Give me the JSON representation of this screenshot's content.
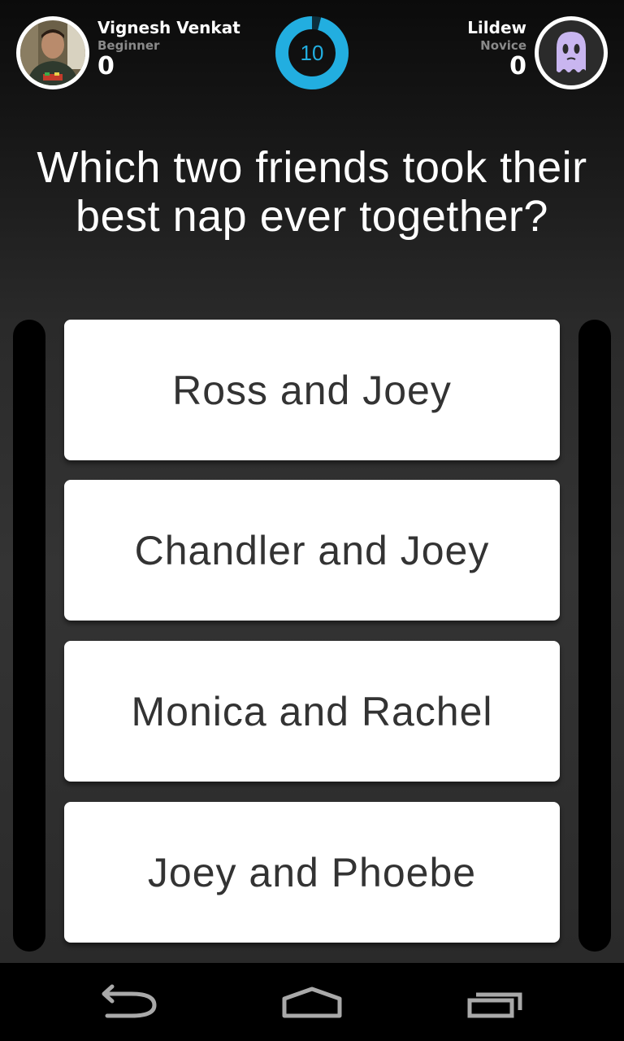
{
  "header": {
    "player_left": {
      "name": "Vignesh Venkat",
      "rank": "Beginner",
      "score": "0",
      "avatar": "profile-photo"
    },
    "timer": {
      "value": "10",
      "remaining_fraction": 0.96,
      "color": "#22aee0"
    },
    "player_right": {
      "name": "Lildew",
      "rank": "Novice",
      "score": "0",
      "avatar": "ghost-avatar"
    }
  },
  "question": {
    "text": "Which two friends took their best nap ever together?"
  },
  "answers": [
    {
      "label": "Ross and Joey"
    },
    {
      "label": "Chandler and Joey"
    },
    {
      "label": "Monica and Rachel"
    },
    {
      "label": "Joey and Phoebe"
    }
  ],
  "navbar": {
    "back": "back-icon",
    "home": "home-icon",
    "recents": "recents-icon"
  },
  "colors": {
    "accent": "#22aee0",
    "answer_background": "#ffffff",
    "answer_text": "#333333",
    "ghost": "#c9b6f0"
  }
}
